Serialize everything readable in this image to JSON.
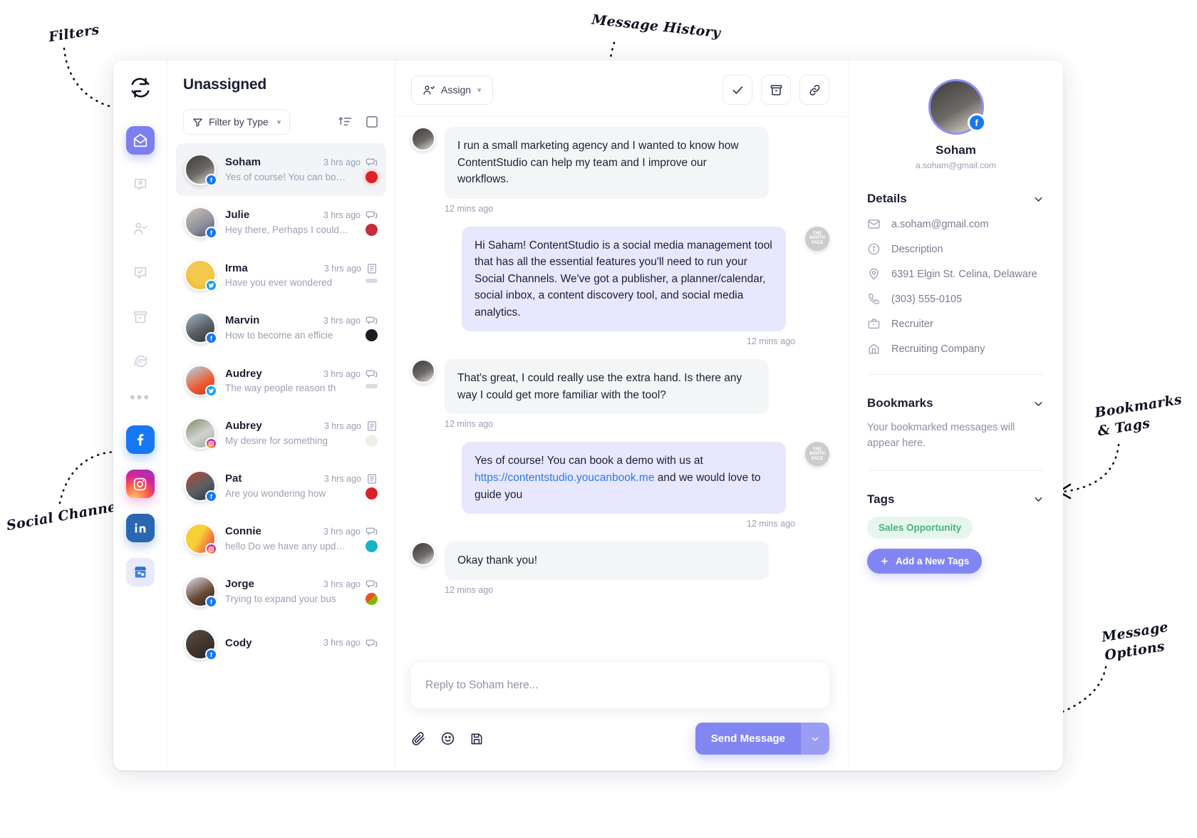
{
  "annotations": [
    {
      "id": "filters",
      "label": "Filters"
    },
    {
      "id": "message_history",
      "label": "Message History"
    },
    {
      "id": "bookmarks_tags",
      "label": "Bookmarks\n& Tags"
    },
    {
      "id": "social_channels",
      "label": "Social Channels"
    },
    {
      "id": "message_options",
      "label": "Message\nOptions"
    }
  ],
  "rail": {
    "logo_icon": "refresh-icon",
    "items": [
      {
        "icon": "inbox-open-envelope-icon",
        "active": true
      },
      {
        "icon": "contact-card-icon",
        "active": false
      },
      {
        "icon": "user-check-icon",
        "active": false
      },
      {
        "icon": "task-check-icon",
        "active": false
      },
      {
        "icon": "archive-box-icon",
        "active": false
      },
      {
        "icon": "chat-list-icon",
        "active": false
      }
    ],
    "more_icon": "more-dots-icon",
    "channels": [
      {
        "icon": "facebook-icon",
        "name": "Facebook"
      },
      {
        "icon": "instagram-icon",
        "name": "Instagram"
      },
      {
        "icon": "linkedin-icon",
        "name": "LinkedIn"
      },
      {
        "icon": "google-my-business-icon",
        "name": "Google My Business"
      }
    ]
  },
  "conversations": {
    "title": "Unassigned",
    "filter_label": "Filter by Type",
    "filter_icon": "funnel-icon",
    "sort_icon": "sort-ascending-icon",
    "select_icon": "checkbox-empty-icon",
    "items": [
      {
        "name": "Soham",
        "time": "3 hrs ago",
        "preview": "Yes of course! You can book...",
        "network": "fb",
        "brand": "tnf",
        "type_icon": "messages-icon",
        "selected": true
      },
      {
        "name": "Julie",
        "time": "3 hrs ago",
        "preview": "Hey there, Perhaps I could i...",
        "network": "fb",
        "brand": "red2",
        "type_icon": "messages-icon",
        "selected": false
      },
      {
        "name": "Irma",
        "time": "3 hrs ago",
        "preview": "Have you ever wondered",
        "network": "tw",
        "brand": "grey",
        "type_icon": "post-icon",
        "selected": false
      },
      {
        "name": "Marvin",
        "time": "3 hrs ago",
        "preview": "How to become an efficie",
        "network": "fb",
        "brand": "dark",
        "type_icon": "messages-icon",
        "selected": false
      },
      {
        "name": "Audrey",
        "time": "3 hrs ago",
        "preview": "The way people reason th",
        "network": "tw",
        "brand": "grey",
        "type_icon": "messages-icon",
        "selected": false
      },
      {
        "name": "Aubrey",
        "time": "3 hrs ago",
        "preview": "My desire for something",
        "network": "ig",
        "brand": "env",
        "type_icon": "post-icon",
        "selected": false
      },
      {
        "name": "Pat",
        "time": "3 hrs ago",
        "preview": "Are you wondering how",
        "network": "fb",
        "brand": "mcd",
        "type_icon": "post-icon",
        "selected": false
      },
      {
        "name": "Connie",
        "time": "3 hrs ago",
        "preview": "hello Do we have any update h...",
        "network": "ig",
        "brand": "teal",
        "type_icon": "messages-icon",
        "selected": false
      },
      {
        "name": "Jorge",
        "time": "3 hrs ago",
        "preview": "Trying to expand your bus",
        "network": "fb",
        "brand": "ms",
        "type_icon": "messages-icon",
        "selected": false
      },
      {
        "name": "Cody",
        "time": "3 hrs ago",
        "preview": "",
        "network": "fb",
        "brand": "dark",
        "type_icon": "messages-icon",
        "selected": false
      }
    ]
  },
  "thread": {
    "assign_label": "Assign",
    "assign_icon": "assign-user-icon",
    "actions": [
      {
        "icon": "check-icon",
        "name": "mark-done-button"
      },
      {
        "icon": "archive-icon",
        "name": "archive-button"
      },
      {
        "icon": "link-icon",
        "name": "copy-link-button"
      }
    ],
    "messages": [
      {
        "dir": "in",
        "text": "I run a small marketing agency and I wanted to know how ContentStudio can help my team and I improve our workflows.",
        "time": "12 mins ago"
      },
      {
        "dir": "out",
        "text_before": "Hi Saham! ContentStudio is a social media management tool that has all the essential features you'll need to run your Social Channels. We've got a publisher, a planner/calendar, social inbox, a content discovery tool, and social media analytics.",
        "time": "12 mins ago"
      },
      {
        "dir": "in",
        "text": "That's great, I could really use the extra hand. Is there any way I could get more familiar with the tool?",
        "time": "12 mins ago"
      },
      {
        "dir": "out",
        "text_before": "Yes of course! You can book a demo with us at ",
        "link": "https://contentstudio.youcanbook.me",
        "text_after": " and we would love to guide you",
        "time": "12 mins ago"
      },
      {
        "dir": "in",
        "text": "Okay thank you!",
        "time": "12 mins ago"
      }
    ],
    "composer": {
      "placeholder": "Reply to Soham here...",
      "icons": [
        {
          "icon": "paperclip-icon",
          "name": "attach-file-button"
        },
        {
          "icon": "emoji-smiley-icon",
          "name": "emoji-button"
        },
        {
          "icon": "save-draft-icon",
          "name": "save-draft-button"
        }
      ],
      "send_label": "Send Message",
      "send_chevron_icon": "chevron-down-icon"
    }
  },
  "details_panel": {
    "profile": {
      "name": "Soham",
      "email": "a.soham@gmail.com",
      "network_badge": "facebook-icon"
    },
    "details_title": "Details",
    "details_rows": [
      {
        "icon": "envelope-icon",
        "value": "a.soham@gmail.com"
      },
      {
        "icon": "info-circle-icon",
        "value": "Description"
      },
      {
        "icon": "location-pin-icon",
        "value": "6391 Elgin St. Celina, Delaware"
      },
      {
        "icon": "phone-icon",
        "value": "(303) 555-0105"
      },
      {
        "icon": "briefcase-icon",
        "value": "Recruiter"
      },
      {
        "icon": "building-icon",
        "value": "Recruiting Company"
      }
    ],
    "bookmarks_title": "Bookmarks",
    "bookmarks_empty": "Your bookmarked messages will appear here.",
    "tags_title": "Tags",
    "tags": [
      "Sales Opportunity"
    ],
    "add_tag_label": "Add a New Tags",
    "add_tag_icon": "plus-icon",
    "collapse_icon": "chevron-down-icon"
  },
  "colors": {
    "accent": "#8286f2",
    "out_bubble": "#e7e8fd",
    "in_bubble": "#f4f5f7",
    "link": "#2f77f0",
    "tag_bg": "#e6f6ed",
    "tag_text": "#49b37b"
  }
}
